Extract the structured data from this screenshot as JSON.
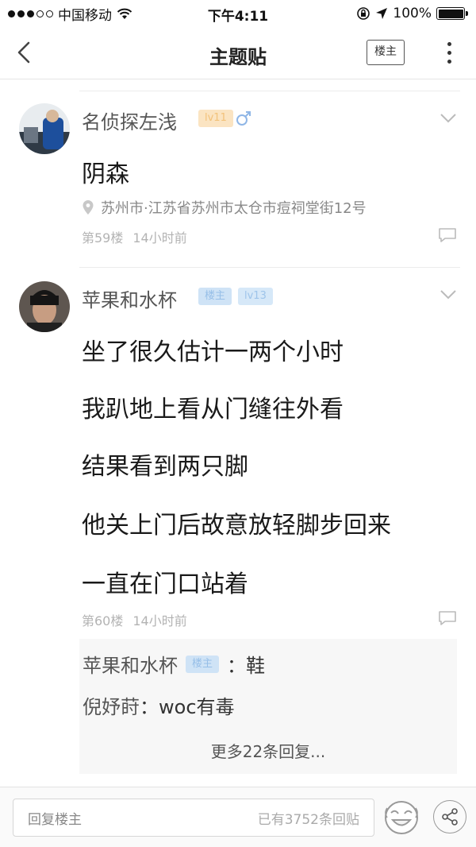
{
  "status_bar": {
    "carrier": "中国移动",
    "time": "下午4:11",
    "battery": "100%"
  },
  "nav": {
    "title": "主题贴",
    "louzhu_label": "楼主"
  },
  "posts": [
    {
      "username": "名侦探左浅",
      "level": "lv11",
      "content": [
        "阴森"
      ],
      "location": "苏州市·江苏省苏州市太仓市痘祠堂街12号",
      "floor": "第59楼",
      "time": "14小时前"
    },
    {
      "username": "苹果和水杯",
      "host_badge": "楼主",
      "level": "lv13",
      "content": [
        "坐了很久估计一两个小时",
        "我趴地上看从门缝往外看",
        "结果看到两只脚",
        "他关上门后故意放轻脚步回来",
        "一直在门口站着"
      ],
      "floor": "第60楼",
      "time": "14小时前",
      "sub_replies": [
        {
          "name": "苹果和水杯",
          "badge": "楼主",
          "sep": "：",
          "text": "鞋"
        },
        {
          "name": "倪妤莳",
          "sep": "：",
          "text": "woc有毒"
        }
      ],
      "more_replies": "更多22条回复..."
    }
  ],
  "bottom_bar": {
    "input_placeholder": "回复楼主",
    "reply_count": "已有3752条回贴"
  }
}
